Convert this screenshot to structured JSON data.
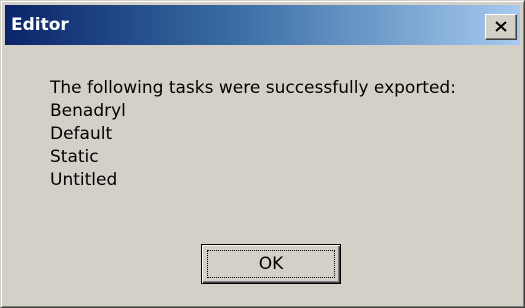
{
  "window": {
    "title": "Editor",
    "close_icon": "close-icon"
  },
  "message": {
    "heading": "The following tasks were successfully exported:",
    "tasks": [
      "Benadryl",
      "Default",
      "Static",
      "Untitled"
    ]
  },
  "buttons": {
    "ok_label": "OK"
  },
  "colors": {
    "title_gradient_start": "#0a246a",
    "title_gradient_end": "#a6caf0",
    "dialog_face": "#d4d0c8"
  }
}
